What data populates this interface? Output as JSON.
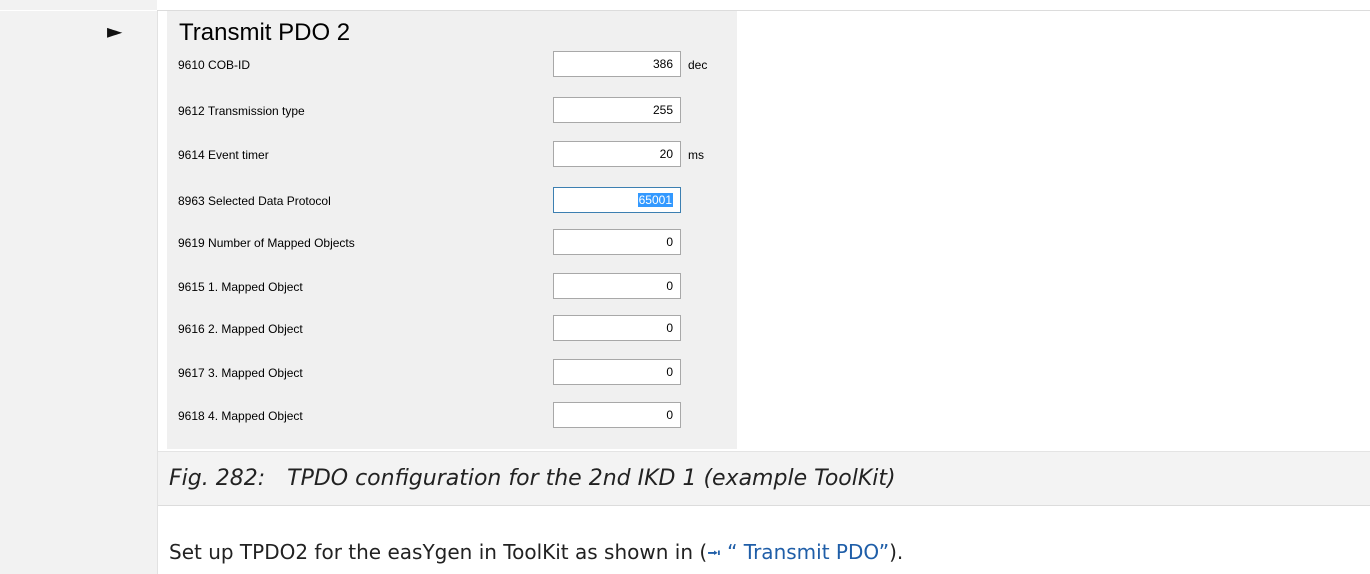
{
  "marker": "►",
  "toolkit": {
    "title": "Transmit PDO 2",
    "rows": [
      {
        "label": "9610 COB-ID",
        "value": "386",
        "unit": "dec"
      },
      {
        "label": "9612 Transmission type",
        "value": "255",
        "unit": ""
      },
      {
        "label": "9614 Event timer",
        "value": "20",
        "unit": "ms"
      },
      {
        "label": "8963 Selected Data Protocol",
        "value": "65001",
        "unit": ""
      },
      {
        "label": "9619 Number of Mapped Objects",
        "value": "0",
        "unit": ""
      },
      {
        "label": "9615 1. Mapped Object",
        "value": "0",
        "unit": ""
      },
      {
        "label": "9616 2. Mapped Object",
        "value": "0",
        "unit": ""
      },
      {
        "label": "9617 3. Mapped Object",
        "value": "0",
        "unit": ""
      },
      {
        "label": "9618 4. Mapped Object",
        "value": "0",
        "unit": ""
      }
    ]
  },
  "caption": {
    "number": "Fig. 282:",
    "text": "TPDO configuration for the 2nd IKD 1 (example ToolKit)"
  },
  "instruction": {
    "before": "Set up TPDO2 for the easYgen in ToolKit as shown in (",
    "xref_icon": "⭲",
    "xref_text": " “ Transmit PDO”",
    "after": ")."
  },
  "colors": {
    "gutter": "#f2f2f2",
    "panel": "#f0f0f0",
    "link": "#1f5ea8",
    "selection": "#3399ff"
  }
}
